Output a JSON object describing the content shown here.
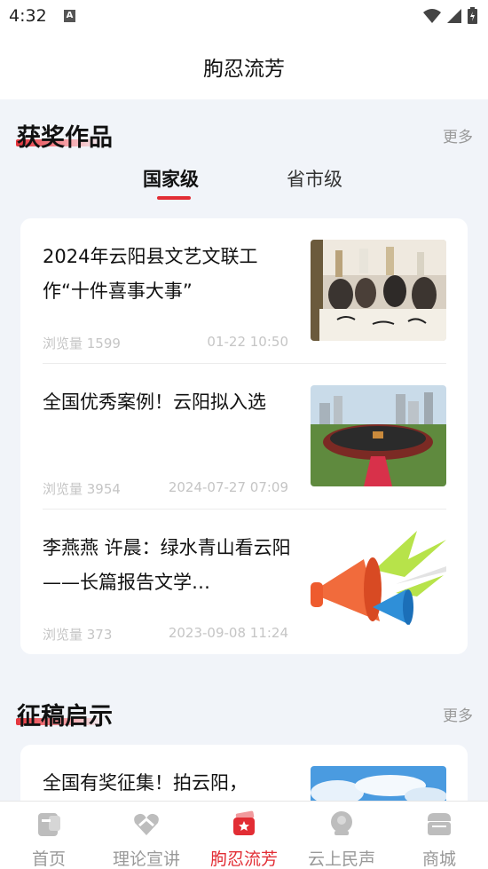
{
  "status_bar": {
    "time": "4:32",
    "notification_icon_letter": "A"
  },
  "header": {
    "title": "朐忍流芳"
  },
  "awards": {
    "heading": "获奖作品",
    "more": "更多",
    "tabs": [
      {
        "label": "国家级",
        "active": true
      },
      {
        "label": "省市级",
        "active": false
      }
    ],
    "items": [
      {
        "title": "2024年云阳县文艺文联工作“十件喜事大事”",
        "views": "浏览量 1599",
        "date": "01-22 10:50",
        "thumb": "calligraphy-event-photo"
      },
      {
        "title": "全国优秀案例！云阳拟入选",
        "views": "浏览量 3954",
        "date": "2024-07-27 07:09",
        "thumb": "circular-plaza-aerial-photo"
      },
      {
        "title": "李燕燕 许晨：绿水青山看云阳——长篇报告文学…",
        "views": "浏览量 373",
        "date": "2023-09-08 11:24",
        "thumb": "megaphone-illustration"
      }
    ]
  },
  "solicitation": {
    "heading": "征稿启示",
    "more": "更多",
    "items": [
      {
        "title": "全国有奖征集！拍云阳，",
        "thumb": "blue-sky-photo"
      }
    ]
  },
  "bottom_nav": [
    {
      "label": "首页",
      "icon": "home-icon",
      "active": false
    },
    {
      "label": "理论宣讲",
      "icon": "heart-hands-icon",
      "active": false
    },
    {
      "label": "朐忍流芳",
      "icon": "ticket-star-icon",
      "active": true
    },
    {
      "label": "云上民声",
      "icon": "person-icon",
      "active": false
    },
    {
      "label": "商城",
      "icon": "shop-icon",
      "active": false
    }
  ],
  "colors": {
    "accent": "#e22d34",
    "background": "#f1f4f9",
    "muted_text": "#c5c5c5"
  }
}
